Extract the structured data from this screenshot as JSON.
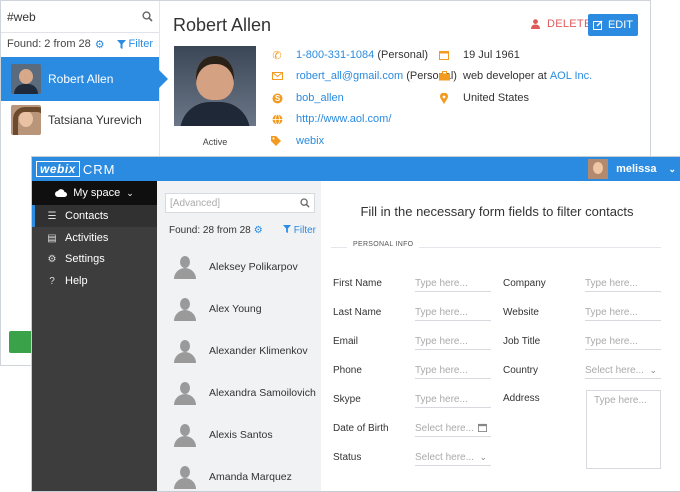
{
  "back": {
    "search_value": "#web",
    "found_text": "Found: 2 from 28",
    "filter_label": "Filter",
    "contacts": [
      {
        "name": "Robert Allen",
        "selected": true
      },
      {
        "name": "Tatsiana Yurevich",
        "selected": false
      }
    ],
    "profile": {
      "name": "Robert Allen",
      "delete_label": "DELETE",
      "edit_label": "EDIT",
      "status": "Active",
      "phone": "1-800-331-1084",
      "phone_type": "(Personal)",
      "email": "robert_all@gmail.com",
      "email_type": "(Personal)",
      "skype": "bob_allen",
      "website": "http://www.aol.com/",
      "tag": "webix",
      "birthday": "19 Jul 1961",
      "job_prefix": "web developer at",
      "company": "AOL Inc.",
      "country": "United States"
    },
    "icons": {
      "phone": "phone-icon",
      "email": "envelope-icon",
      "skype": "skype-icon",
      "website": "globe-icon",
      "tag": "tags-icon",
      "birthday": "calendar-icon",
      "job": "briefcase-icon",
      "location": "map-marker-icon"
    }
  },
  "app": {
    "logo_text": "webix",
    "logo_suffix": "CRM",
    "user_name": "melissa",
    "space_label": "My space",
    "nav": [
      {
        "label": "Contacts",
        "icon": "list-icon",
        "selected": true
      },
      {
        "label": "Activities",
        "icon": "table-icon",
        "selected": false
      },
      {
        "label": "Settings",
        "icon": "gear-icon",
        "selected": false
      },
      {
        "label": "Help",
        "icon": "question-icon",
        "selected": false
      }
    ],
    "list": {
      "search_placeholder": "[Advanced]",
      "found_text": "Found: 28 from 28",
      "filter_label": "Filter",
      "contacts": [
        "Aleksey Polikarpov",
        "Alex Young",
        "Alexander Klimenkov",
        "Alexandra Samoilovich",
        "Alexis Santos",
        "Amanda Marquez"
      ]
    },
    "form": {
      "title": "Fill in the necessary form fields to filter contacts",
      "section": "PERSONAL INFO",
      "placeholder": "Type here...",
      "select_placeholder": "Select here...",
      "left_fields": [
        "First Name",
        "Last Name",
        "Email",
        "Phone",
        "Skype",
        "Date of Birth",
        "Status"
      ],
      "right_fields": [
        "Company",
        "Website",
        "Job Title",
        "Country",
        "Address"
      ]
    }
  },
  "colors": {
    "accent": "#2a8be0",
    "orange": "#f39b20",
    "danger": "#e05a5a",
    "sidebar": "#3d3d3d"
  }
}
